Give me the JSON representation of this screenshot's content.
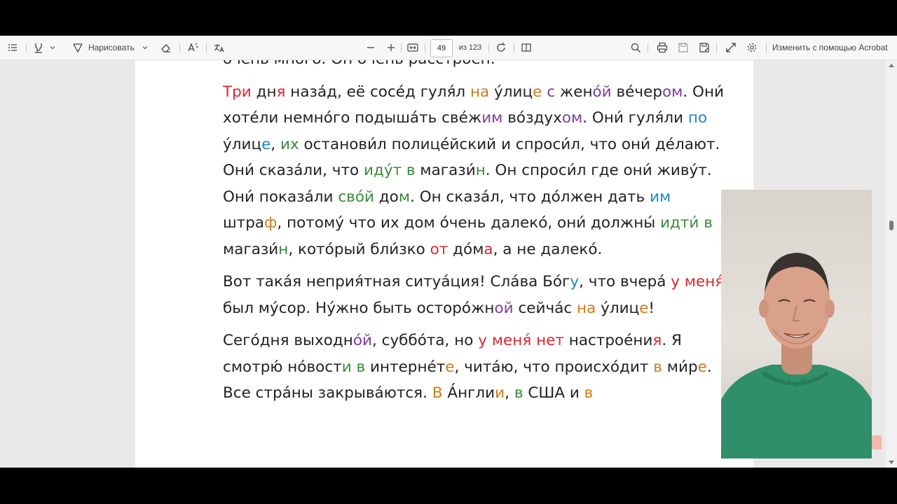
{
  "toolbar": {
    "draw_label": "Нарисовать",
    "page_current": "49",
    "page_total": "из 123",
    "edit_acrobat_label": "Изменить с помощью Acrobat",
    "icons": [
      "list-icon",
      "highlighter-icon",
      "chevron-down-icon",
      "draw-icon",
      "eraser-icon",
      "read-aloud-icon",
      "translate-icon",
      "zoom-out-icon",
      "zoom-in-icon",
      "fit-page-icon",
      "rotate-icon",
      "page-view-icon",
      "search-icon",
      "print-icon",
      "save-icon",
      "save-as-icon",
      "fullscreen-icon",
      "settings-icon"
    ]
  },
  "document": {
    "line0": "о́чень мно́го. Он о́чень расстро́ен.",
    "p1": [
      [
        "Три",
        "r"
      ],
      [
        " дн",
        ""
      ],
      [
        "я",
        "r"
      ],
      [
        " наза́д, её сосе́д гуля́л ",
        ""
      ],
      [
        "на",
        "o"
      ],
      [
        " у́лиц",
        ""
      ],
      [
        "е",
        "o"
      ],
      [
        " ",
        ""
      ],
      [
        "с",
        "p"
      ],
      [
        " жен",
        ""
      ],
      [
        "о́й",
        "p"
      ],
      [
        " ве́чер",
        ""
      ],
      [
        "ом",
        "p"
      ],
      [
        ". Они́ хоте́ли немно́го подыша́ть све́ж",
        ""
      ],
      [
        "им",
        "p"
      ],
      [
        " во́здух",
        ""
      ],
      [
        "ом",
        "p"
      ],
      [
        ". Они́ гуля́ли ",
        ""
      ],
      [
        "по",
        "b"
      ],
      [
        " у́лиц",
        ""
      ],
      [
        "е",
        "b"
      ],
      [
        ", ",
        ""
      ],
      [
        "их",
        "g"
      ],
      [
        " останови́л полице́йский и спроси́л, что они́ де́лают. Они́ сказа́ли, что ",
        ""
      ],
      [
        "иду́т в",
        "g"
      ],
      [
        " магази́",
        ""
      ],
      [
        "н",
        "g"
      ],
      [
        ". Он спроси́л где они́ живу́т. Они́ показа́ли ",
        ""
      ],
      [
        "сво́й",
        "g"
      ],
      [
        " до",
        ""
      ],
      [
        "м",
        "g"
      ],
      [
        ". Он сказа́л, что до́лжен дать ",
        ""
      ],
      [
        "им",
        "b"
      ],
      [
        " штра",
        ""
      ],
      [
        "ф",
        "o"
      ],
      [
        ", потому́ что их дом о́чень далеко́, они́ должны́ ",
        ""
      ],
      [
        "идти́ в",
        "g"
      ],
      [
        " магази́",
        ""
      ],
      [
        "н",
        "g"
      ],
      [
        ", кото́рый бли́зко ",
        ""
      ],
      [
        "от",
        "r"
      ],
      [
        " до́м",
        ""
      ],
      [
        "а",
        "r"
      ],
      [
        ", а не далеко́.",
        ""
      ]
    ],
    "p2": [
      [
        "Вот така́я неприя́тная ситуа́ция! Сла́ва Бо́г",
        ""
      ],
      [
        "у",
        "b"
      ],
      [
        ", что вчера́ ",
        ""
      ],
      [
        "у меня́",
        "r"
      ],
      [
        " был му́сор. Ну́жно быть осторо́жн",
        ""
      ],
      [
        "ой",
        "p"
      ],
      [
        " сейча́с ",
        ""
      ],
      [
        "на",
        "o"
      ],
      [
        " у́лиц",
        ""
      ],
      [
        "е",
        "o"
      ],
      [
        "!",
        ""
      ]
    ],
    "p3": [
      [
        "Сего́дня выходн",
        ""
      ],
      [
        "о́й",
        "p"
      ],
      [
        ", суббо́та, но ",
        ""
      ],
      [
        "у меня́ нет",
        "r"
      ],
      [
        " настрое́ни",
        ""
      ],
      [
        "я",
        "r"
      ],
      [
        ". Я смотрю́ но́вост",
        ""
      ],
      [
        "и",
        "g"
      ],
      [
        " ",
        ""
      ],
      [
        "в",
        "g"
      ],
      [
        " интерне́т",
        ""
      ],
      [
        "е",
        "o"
      ],
      [
        ", чита́ю, что происхо́дит ",
        ""
      ],
      [
        "в",
        "o"
      ],
      [
        " ми́р",
        ""
      ],
      [
        "е",
        "o"
      ],
      [
        ". Все стра́ны закрыва́ются. ",
        ""
      ],
      [
        "В",
        "o"
      ],
      [
        " А́нгли",
        ""
      ],
      [
        "и",
        "o"
      ],
      [
        ", ",
        ""
      ],
      [
        "в",
        "g"
      ],
      [
        " США и ",
        ""
      ],
      [
        "в",
        "o"
      ]
    ]
  },
  "colors": {
    "r": "#d9272e",
    "o": "#d07a1c",
    "p": "#7c3aa0",
    "b": "#1c86c8",
    "g": "#3a8a3a"
  }
}
